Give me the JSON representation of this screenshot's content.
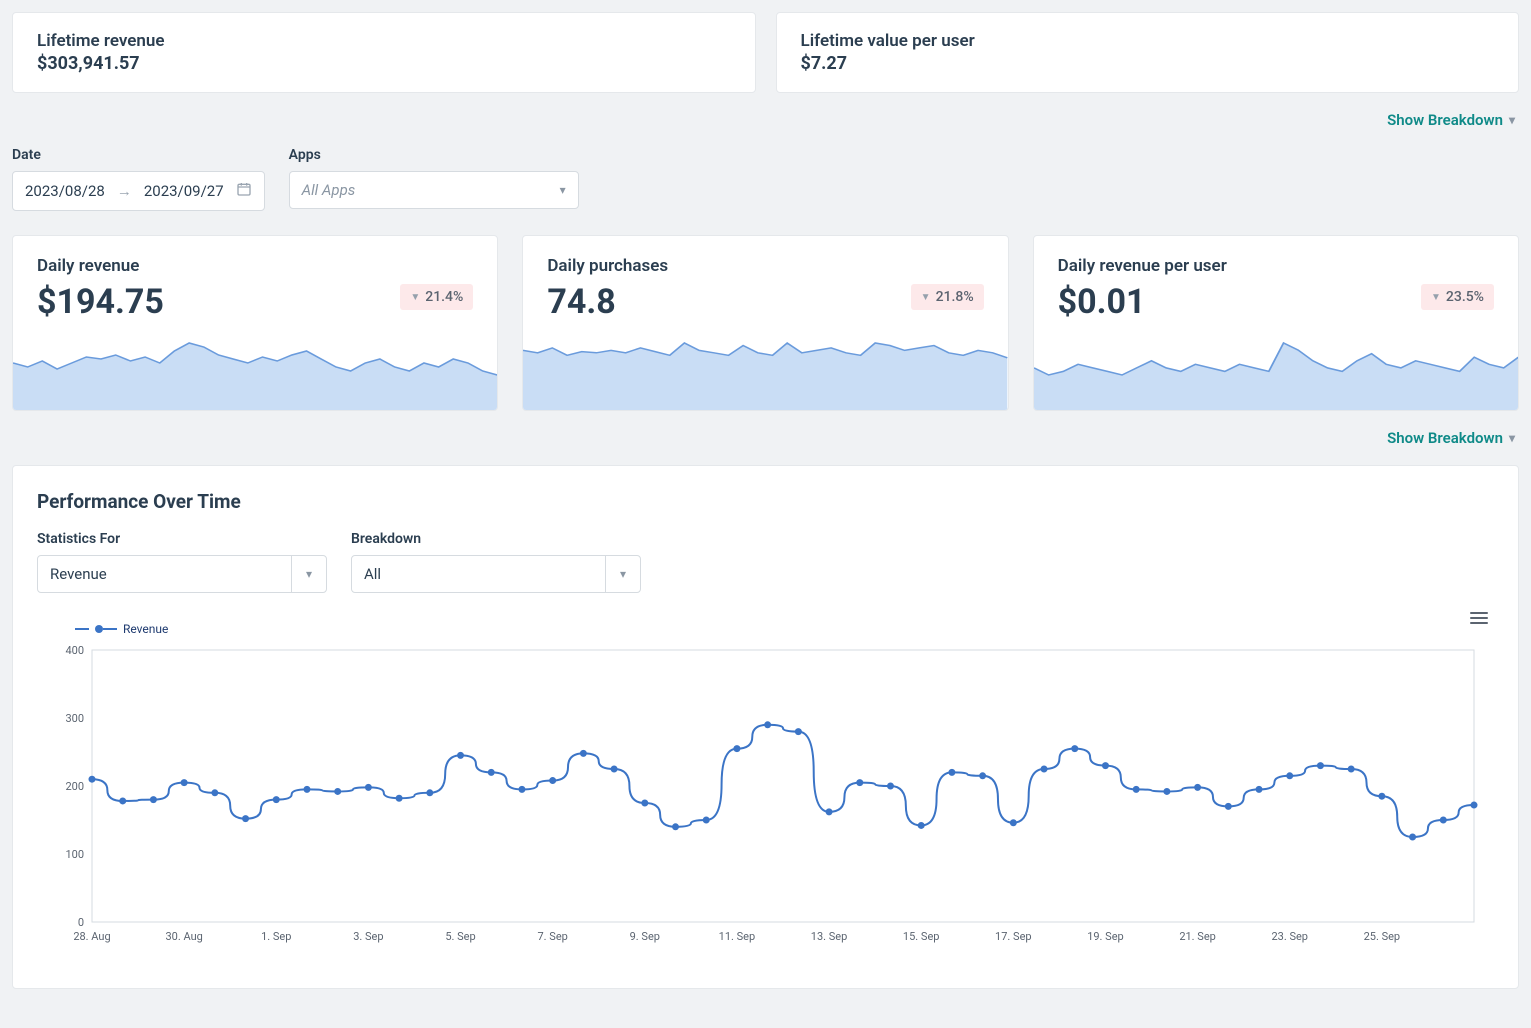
{
  "lifetime": {
    "revenue_label": "Lifetime revenue",
    "revenue_value": "$303,941.57",
    "lvpu_label": "Lifetime value per user",
    "lvpu_value": "$7.27"
  },
  "breakdown_label": "Show Breakdown",
  "filters": {
    "date_label": "Date",
    "date_start": "2023/08/28",
    "date_end": "2023/09/27",
    "apps_label": "Apps",
    "apps_value": "All Apps"
  },
  "stats": {
    "daily_revenue": {
      "label": "Daily revenue",
      "value": "$194.75",
      "delta": "21.4%"
    },
    "daily_purchases": {
      "label": "Daily purchases",
      "value": "74.8",
      "delta": "21.8%"
    },
    "daily_rpu": {
      "label": "Daily revenue per user",
      "value": "$0.01",
      "delta": "23.5%"
    }
  },
  "perf": {
    "title": "Performance Over Time",
    "stat_for_label": "Statistics For",
    "stat_for_value": "Revenue",
    "breakdown_label": "Breakdown",
    "breakdown_value": "All",
    "legend": "Revenue"
  },
  "chart_data": {
    "type": "line",
    "title": "Performance Over Time",
    "series": [
      {
        "name": "Revenue",
        "values": [
          210,
          178,
          180,
          205,
          190,
          152,
          180,
          195,
          192,
          198,
          182,
          190,
          245,
          220,
          195,
          208,
          248,
          225,
          175,
          140,
          150,
          255,
          290,
          280,
          162,
          205,
          200,
          142,
          220,
          215,
          146,
          225,
          255,
          230,
          195,
          192,
          198,
          170,
          195,
          215,
          230,
          225,
          185,
          125,
          150,
          172
        ]
      }
    ],
    "x": [
      "28. Aug",
      "29. Aug",
      "30. Aug",
      "31. Aug",
      "1. Sep",
      "2. Sep",
      "3. Sep",
      "4. Sep",
      "5. Sep",
      "6. Sep",
      "7. Sep",
      "8. Sep",
      "9. Sep",
      "10. Sep",
      "11. Sep",
      "12. Sep",
      "13. Sep",
      "14. Sep",
      "15. Sep",
      "16. Sep",
      "17. Sep",
      "18. Sep",
      "19. Sep",
      "20. Sep",
      "21. Sep",
      "22. Sep",
      "23. Sep",
      "24. Sep",
      "25. Sep",
      "26. Sep",
      "27. Sep"
    ],
    "x_tick_labels": [
      "28. Aug",
      "30. Aug",
      "1. Sep",
      "3. Sep",
      "5. Sep",
      "7. Sep",
      "9. Sep",
      "11. Sep",
      "13. Sep",
      "15. Sep",
      "17. Sep",
      "19. Sep",
      "21. Sep",
      "23. Sep",
      "25. Sep"
    ],
    "y_ticks": [
      0,
      100,
      200,
      300,
      400
    ],
    "ylim": [
      0,
      400
    ],
    "xlabel": "",
    "ylabel": ""
  },
  "spark_data": {
    "revenue": [
      22,
      20,
      23,
      19,
      22,
      25,
      24,
      26,
      23,
      25,
      22,
      28,
      32,
      30,
      26,
      24,
      22,
      25,
      23,
      26,
      28,
      24,
      20,
      18,
      22,
      24,
      20,
      18,
      22,
      20,
      24,
      22,
      18,
      16
    ],
    "purchases": [
      46,
      44,
      48,
      42,
      45,
      44,
      46,
      44,
      48,
      45,
      42,
      52,
      46,
      44,
      42,
      50,
      44,
      42,
      52,
      44,
      46,
      48,
      44,
      42,
      52,
      50,
      46,
      48,
      50,
      44,
      42,
      46,
      44,
      40
    ],
    "rpu": [
      22,
      18,
      20,
      24,
      22,
      20,
      18,
      22,
      26,
      22,
      20,
      24,
      22,
      20,
      24,
      22,
      20,
      36,
      32,
      26,
      22,
      20,
      26,
      30,
      24,
      22,
      26,
      24,
      22,
      20,
      28,
      24,
      22,
      28
    ]
  }
}
